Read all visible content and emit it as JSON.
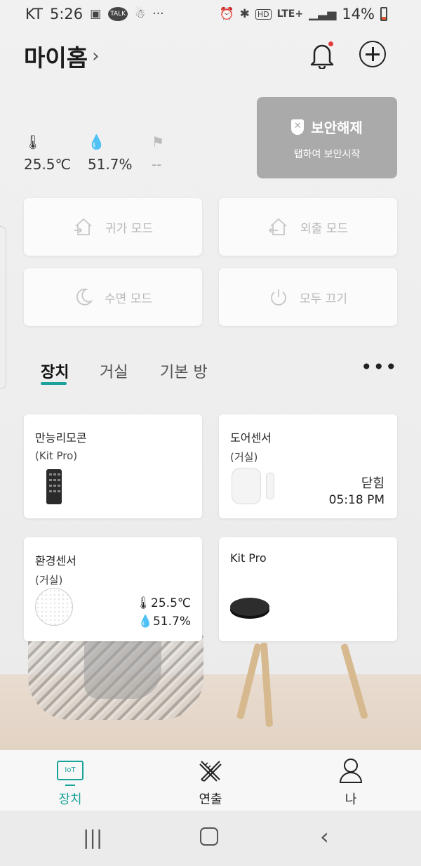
{
  "status_bar": {
    "carrier": "KT",
    "time": "5:26",
    "talk": "TALK",
    "network": "LTE+",
    "battery": "14%"
  },
  "header": {
    "title": "마이홈",
    "chevron": "›"
  },
  "sensors": {
    "temperature": "25.5℃",
    "humidity": "51.7%",
    "air": "--"
  },
  "security": {
    "label": "보안해제",
    "hint": "탭하여 보안시작"
  },
  "modes": [
    {
      "label": "귀가 모드",
      "icon": "home-arrive-icon"
    },
    {
      "label": "외출 모드",
      "icon": "home-leave-icon"
    },
    {
      "label": "수면 모드",
      "icon": "moon-icon"
    },
    {
      "label": "모두 끄기",
      "icon": "power-icon"
    }
  ],
  "tabs": [
    {
      "label": "장치"
    },
    {
      "label": "거실"
    },
    {
      "label": "기본 방"
    }
  ],
  "more_label": "•••",
  "devices": [
    {
      "name": "만능리모콘",
      "room": "(Kit Pro)"
    },
    {
      "name": "도어센서",
      "room": "(거실)",
      "state": "닫힘",
      "time": "05:18 PM"
    },
    {
      "name": "환경센서",
      "room": "(거실)",
      "temperature": "25.5℃",
      "humidity": "51.7%"
    },
    {
      "name": "Kit Pro"
    }
  ],
  "bottom_nav": [
    {
      "label": "장치",
      "icon": "iot-icon",
      "icon_text": "IoT"
    },
    {
      "label": "연출",
      "icon": "tools-icon"
    },
    {
      "label": "나",
      "icon": "person-icon"
    }
  ],
  "colors": {
    "accent": "#1aa39a",
    "security_bg": "#aaaaaa",
    "notification": "#e23b3b"
  }
}
